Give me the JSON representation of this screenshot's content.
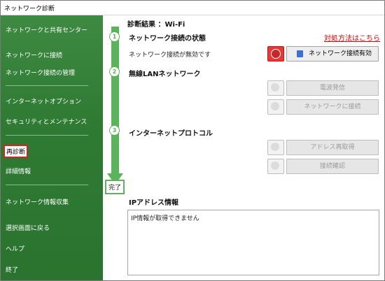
{
  "window": {
    "title": "ネットワーク診断"
  },
  "sidebar": {
    "items": [
      {
        "label": "ネットワークと共有センター"
      },
      {
        "label": "ネットワークに接続"
      },
      {
        "label": "ネットワーク接続の管理"
      },
      {
        "label": "インターネットオプション"
      },
      {
        "label": "セキュリティとメンテナンス"
      },
      {
        "label": "再診断"
      },
      {
        "label": "詳細情報"
      },
      {
        "label": "ネットワーク情報収集"
      },
      {
        "label": "選択画面に戻る"
      },
      {
        "label": "ヘルプ"
      },
      {
        "label": "終了"
      }
    ]
  },
  "main": {
    "result_title": "診断結果 ：Wi-Fi",
    "help_link": "対処方法はこちら",
    "steps": [
      {
        "number": "1",
        "title": "ネットワーク接続の状態",
        "status": "ネットワーク接続が無効です",
        "button": "ネットワーク接続有効"
      },
      {
        "number": "2",
        "title": "無線LANネットワーク",
        "buttons": [
          "電波発信",
          "ネットワークに接続"
        ]
      },
      {
        "number": "3",
        "title": "インターネットプロトコル",
        "buttons": [
          "アドレス再取得",
          "接続確認"
        ]
      }
    ],
    "done_label": "完了",
    "ip_section": {
      "title": "IPアドレス情報",
      "text": "IP情報が取得できません"
    }
  },
  "colors": {
    "sidebar_green": "#2f7b33",
    "accent_green": "#5bb35b",
    "link_red": "#e00000"
  }
}
